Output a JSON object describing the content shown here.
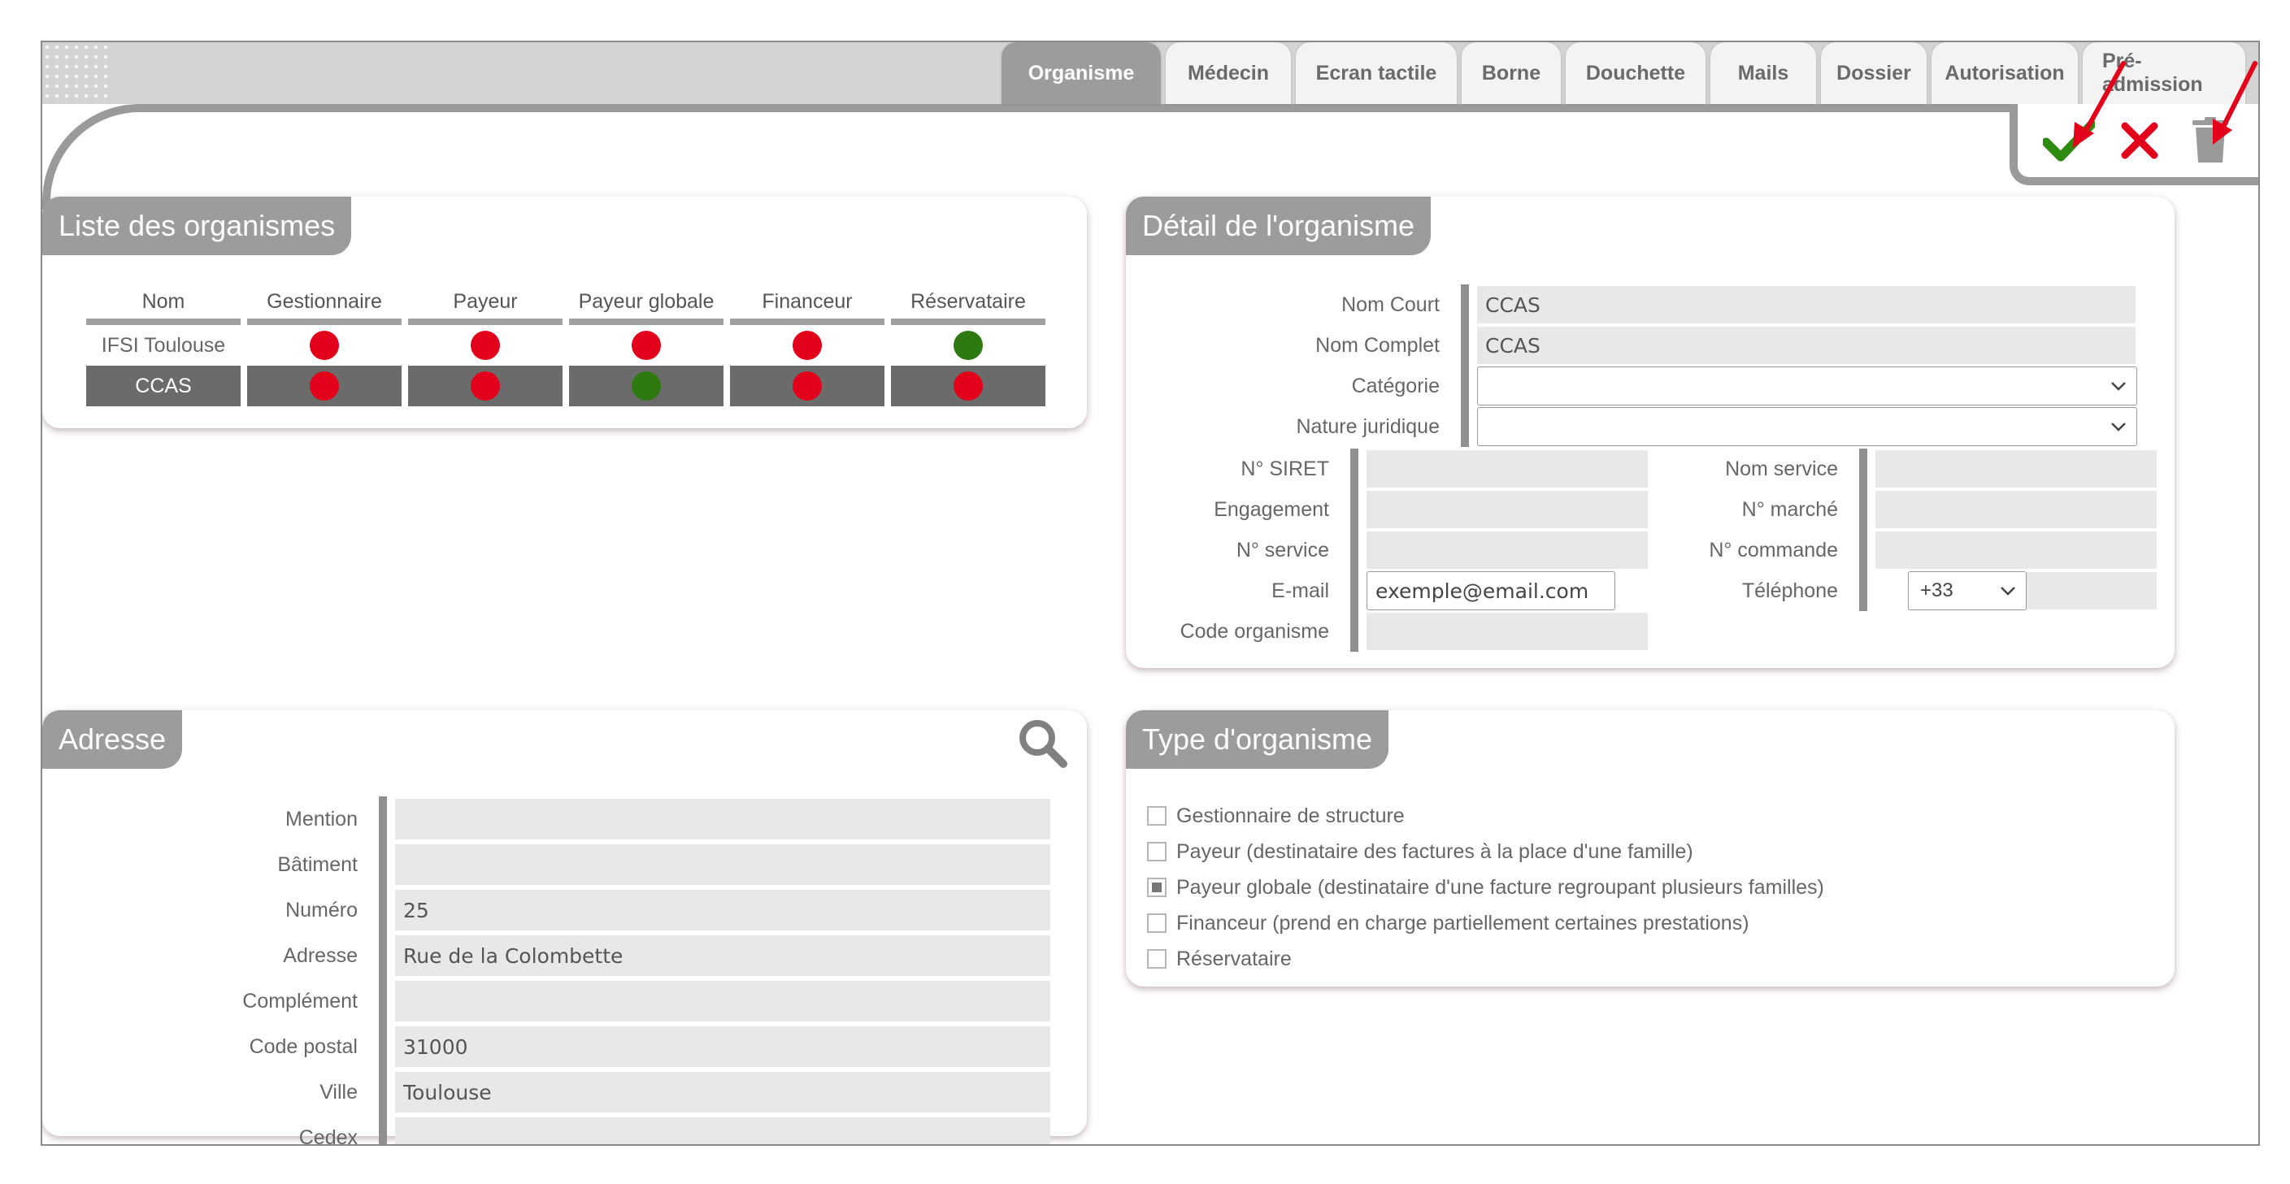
{
  "tabs": [
    {
      "label": "Organisme",
      "active": true
    },
    {
      "label": "Médecin",
      "active": false
    },
    {
      "label": "Ecran tactile",
      "active": false
    },
    {
      "label": "Borne",
      "active": false
    },
    {
      "label": "Douchette",
      "active": false
    },
    {
      "label": "Mails",
      "active": false
    },
    {
      "label": "Dossier",
      "active": false
    },
    {
      "label": "Autorisation",
      "active": false
    },
    {
      "label": "Pré-admission",
      "active": false
    }
  ],
  "toolbar": {
    "validate_icon": "check-icon",
    "cancel_icon": "close-icon",
    "delete_icon": "trash-icon"
  },
  "colors": {
    "accent_grey": "#9c9c9c",
    "status_red": "#e3001b",
    "status_green": "#2e7a10",
    "selected_row": "#6b6b6b",
    "validate_green": "#2e8a10",
    "arrow_red": "#e3001b"
  },
  "liste": {
    "title": "Liste des organismes",
    "columns": [
      "Nom",
      "Gestionnaire",
      "Payeur",
      "Payeur globale",
      "Financeur",
      "Réservataire"
    ],
    "rows": [
      {
        "nom": "IFSI Toulouse",
        "flags": [
          "red",
          "red",
          "red",
          "red",
          "green"
        ],
        "selected": false
      },
      {
        "nom": "CCAS",
        "flags": [
          "red",
          "red",
          "green",
          "red",
          "red"
        ],
        "selected": true
      }
    ]
  },
  "detail": {
    "title": "Détail de l'organisme",
    "nom_court_label": "Nom Court",
    "nom_court": "CCAS",
    "nom_complet_label": "Nom Complet",
    "nom_complet": "CCAS",
    "categorie_label": "Catégorie",
    "categorie": "",
    "nature_label": "Nature juridique",
    "nature": "",
    "siret_label": "N° SIRET",
    "siret": "",
    "engagement_label": "Engagement",
    "engagement": "",
    "n_service_label": "N° service",
    "n_service": "",
    "email_label": "E-mail",
    "email": "exemple@email.com",
    "code_label": "Code organisme",
    "code": "",
    "nom_service_label": "Nom service",
    "nom_service": "",
    "n_marche_label": "N° marché",
    "n_marche": "",
    "n_commande_label": "N° commande",
    "n_commande": "",
    "telephone_label": "Téléphone",
    "telephone_prefix": "+33",
    "telephone": ""
  },
  "adresse": {
    "title": "Adresse",
    "search_icon": "search-icon",
    "fields": [
      {
        "label": "Mention",
        "value": ""
      },
      {
        "label": "Bâtiment",
        "value": ""
      },
      {
        "label": "Numéro",
        "value": "25"
      },
      {
        "label": "Adresse",
        "value": "Rue de la Colombette"
      },
      {
        "label": "Complément",
        "value": ""
      },
      {
        "label": "Code postal",
        "value": "31000"
      },
      {
        "label": "Ville",
        "value": "Toulouse"
      },
      {
        "label": "Cedex",
        "value": ""
      }
    ]
  },
  "type": {
    "title": "Type d'organisme",
    "options": [
      {
        "label": "Gestionnaire de structure",
        "checked": false
      },
      {
        "label": "Payeur (destinataire des factures à la place d'une famille)",
        "checked": false
      },
      {
        "label": "Payeur globale (destinataire d'une facture regroupant plusieurs familles)",
        "checked": true
      },
      {
        "label": "Financeur (prend en charge partiellement certaines prestations)",
        "checked": false
      },
      {
        "label": "Réservataire",
        "checked": false
      }
    ]
  }
}
